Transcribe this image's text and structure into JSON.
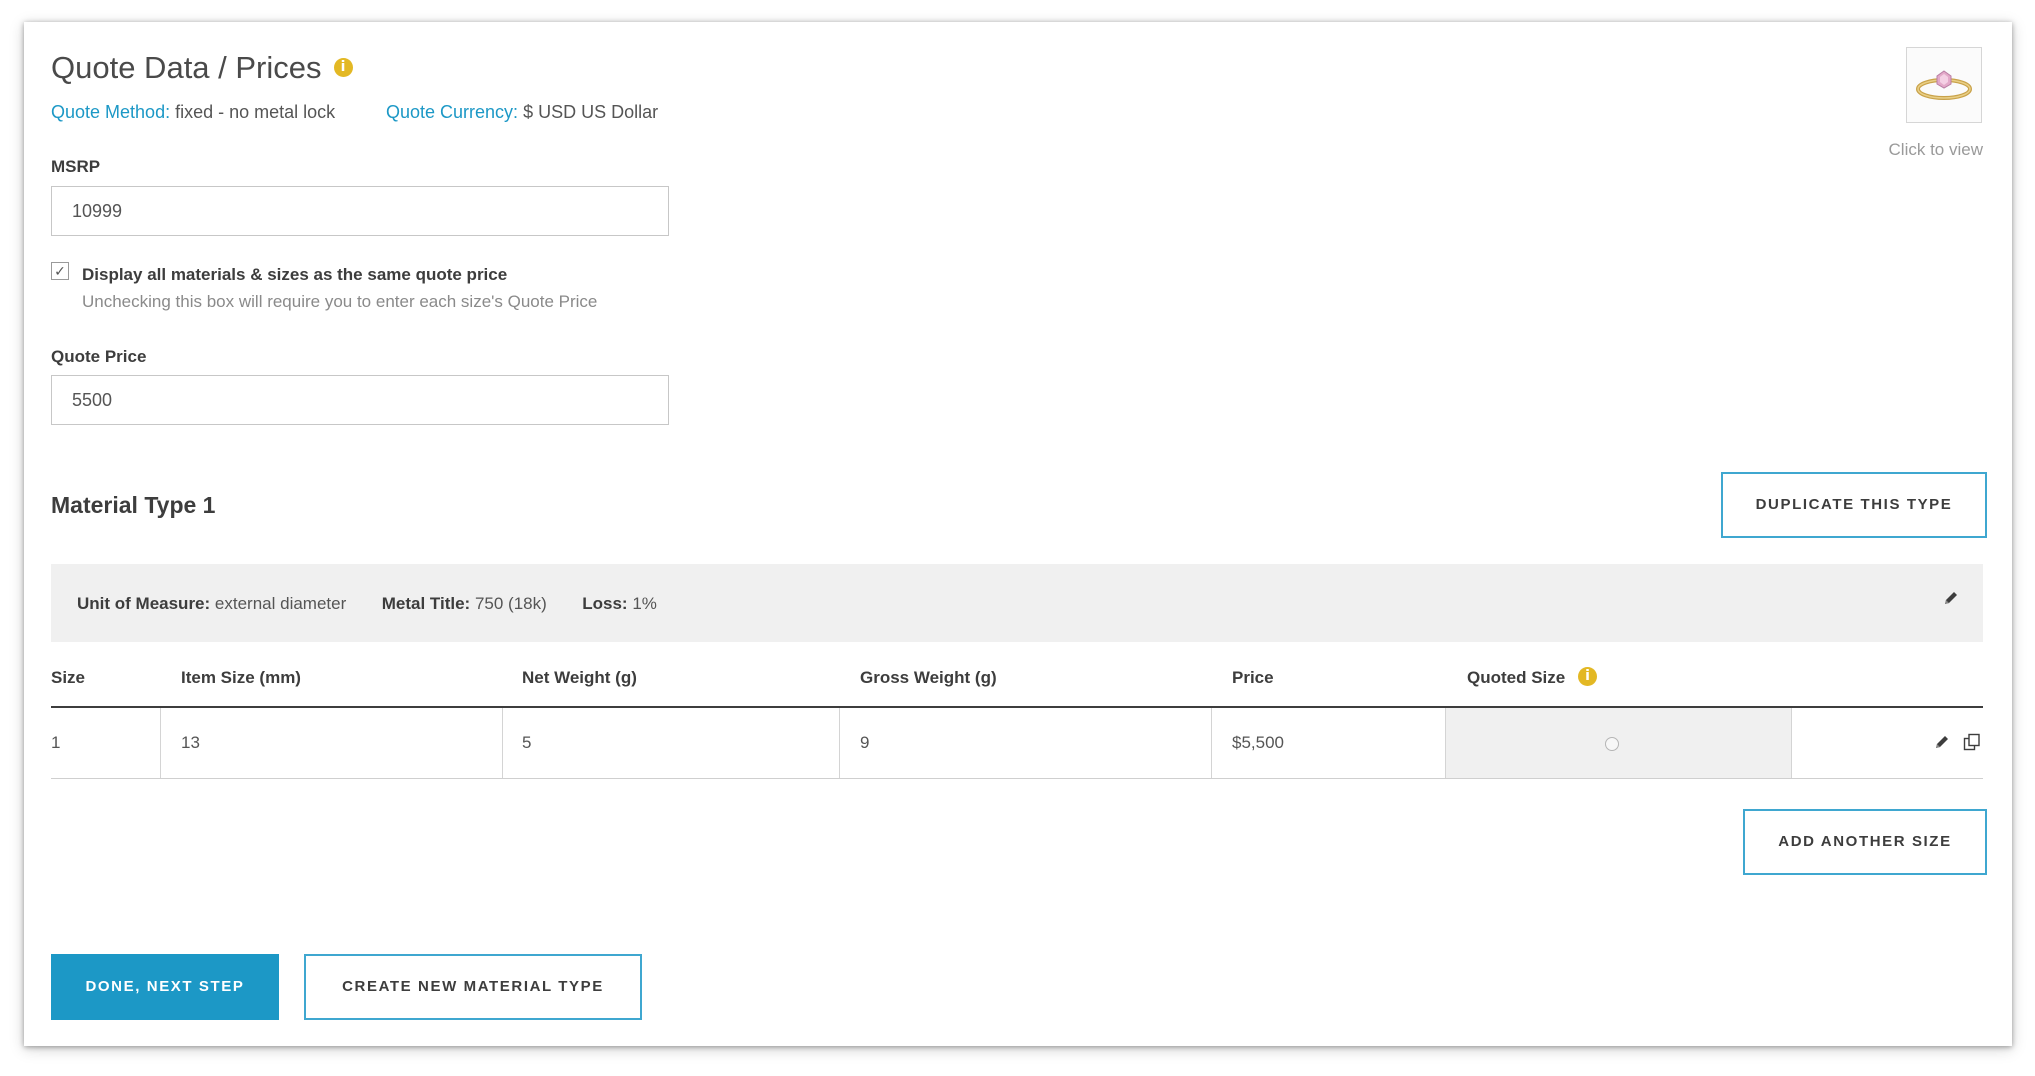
{
  "header": {
    "title": "Quote Data / Prices",
    "quote_method_label": "Quote Method:",
    "quote_method_value": "fixed - no metal lock",
    "quote_currency_label": "Quote Currency:",
    "quote_currency_value": "$ USD US Dollar",
    "info_glyph": "i"
  },
  "thumbnail": {
    "caption": "Click to view"
  },
  "form": {
    "msrp_label": "MSRP",
    "msrp_value": "10999",
    "same_price_checked": true,
    "same_price_label": "Display all materials & sizes as the same quote price",
    "same_price_help": "Unchecking this box will require you to enter each size's Quote Price",
    "quote_price_label": "Quote Price",
    "quote_price_value": "5500"
  },
  "material": {
    "title": "Material Type 1",
    "duplicate_label": "DUPLICATE THIS TYPE",
    "uom_label": "Unit of Measure:",
    "uom_value": "external diameter",
    "metal_title_label": "Metal Title:",
    "metal_title_value": "750 (18k)",
    "loss_label": "Loss:",
    "loss_value": "1%"
  },
  "table": {
    "columns": [
      "Size",
      "Item Size (mm)",
      "Net Weight (g)",
      "Gross Weight (g)",
      "Price",
      "Quoted Size"
    ],
    "rows": [
      {
        "size": "1",
        "item_size": "13",
        "net_weight": "5",
        "gross_weight": "9",
        "price": "$5,500",
        "quoted": false
      }
    ],
    "add_size_label": "ADD ANOTHER SIZE"
  },
  "footer": {
    "done_label": "DONE, NEXT STEP",
    "create_label": "CREATE NEW MATERIAL TYPE"
  },
  "colors": {
    "accent": "#1c98c6",
    "info": "#e3b824",
    "muted_bg": "#f0f0f0"
  }
}
